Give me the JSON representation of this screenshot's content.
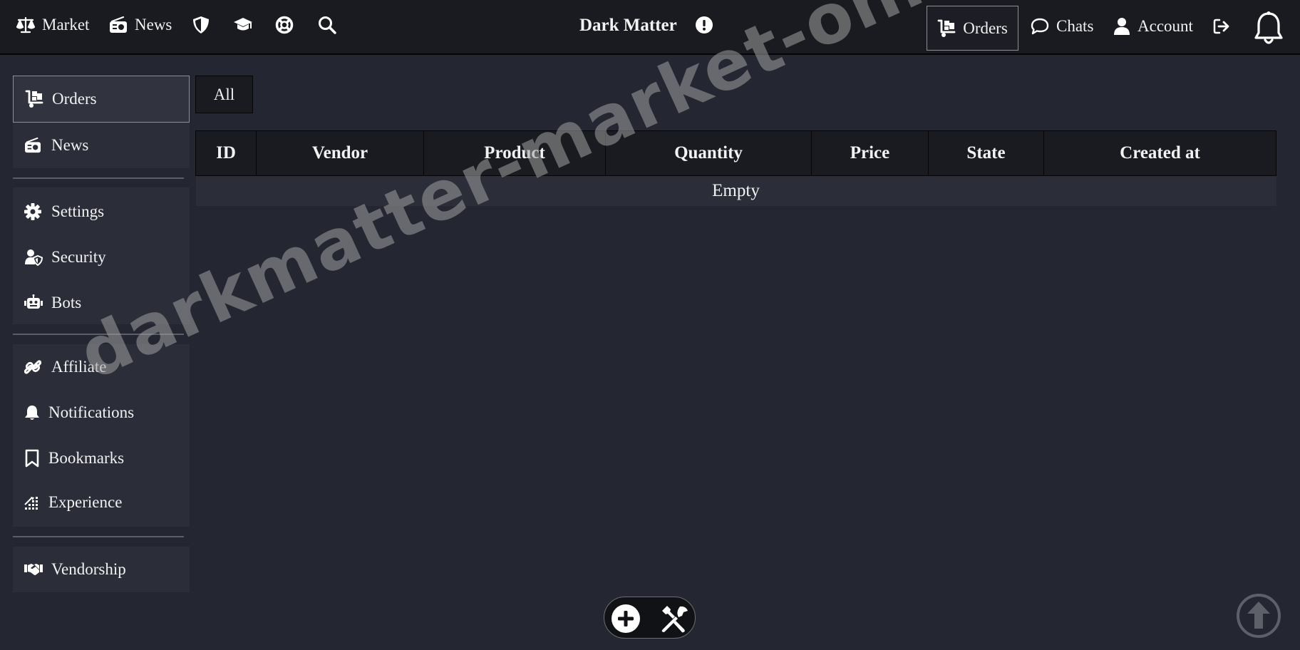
{
  "topbar": {
    "market_label": "Market",
    "news_label": "News",
    "brand": "Dark Matter",
    "orders_label": "Orders",
    "chats_label": "Chats",
    "account_label": "Account",
    "icons": [
      "scales-icon",
      "radio-icon",
      "shield-icon",
      "graduation-cap-icon",
      "life-ring-icon",
      "search-icon",
      "alert-icon",
      "dolly-icon",
      "chat-icon",
      "user-icon",
      "logout-icon",
      "bell-icon"
    ]
  },
  "sidebar": {
    "group1": [
      {
        "label": "Orders",
        "icon": "dolly-icon",
        "active": true
      },
      {
        "label": "News",
        "icon": "radio-icon"
      }
    ],
    "group2": [
      {
        "label": "Settings",
        "icon": "gear-icon"
      },
      {
        "label": "Security",
        "icon": "user-shield-icon"
      },
      {
        "label": "Bots",
        "icon": "robot-icon"
      }
    ],
    "group3": [
      {
        "label": "Affiliate",
        "icon": "link-icon"
      },
      {
        "label": "Notifications",
        "icon": "bell-icon"
      },
      {
        "label": "Bookmarks",
        "icon": "bookmark-icon"
      },
      {
        "label": "Experience",
        "icon": "chart-icon"
      }
    ],
    "group4": [
      {
        "label": "Vendorship",
        "icon": "handshake-icon"
      }
    ]
  },
  "main": {
    "filter_tab": "All",
    "table": {
      "columns": [
        "ID",
        "Vendor",
        "Product",
        "Quantity",
        "Price",
        "State",
        "Created at"
      ],
      "empty_text": "Empty"
    }
  },
  "watermark": "darkmatter-market-onion.cc",
  "colors": {
    "background": "#242631",
    "topbar": "#1a1b21",
    "panel": "#2b2d38",
    "text": "#f2f2f2",
    "border": "#8d8f96"
  }
}
